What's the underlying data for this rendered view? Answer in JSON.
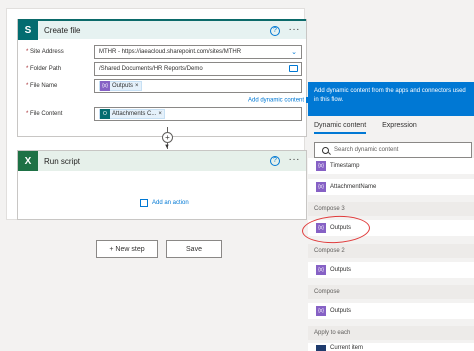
{
  "create_file": {
    "title": "Create file",
    "fields": [
      {
        "label": "Site Address",
        "value": "MTHR - https://iaeacloud.sharepoint.com/sites/MTHR"
      },
      {
        "label": "Folder Path",
        "value": "/Shared Documents/HR Reports/Demo"
      },
      {
        "label": "File Name",
        "token": "Outputs"
      },
      {
        "label": "File Content",
        "token": "Attachments C..."
      }
    ],
    "add_dynamic_content": "Add dynamic content"
  },
  "run_script": {
    "title": "Run script",
    "add_action": "Add an action"
  },
  "buttons": {
    "new_step": "+ New step",
    "save": "Save"
  },
  "dynamic_panel": {
    "banner": "Add dynamic content from the apps and connectors used in this flow.",
    "tabs": [
      "Dynamic content",
      "Expression"
    ],
    "search_placeholder": "Search dynamic content",
    "items": [
      {
        "label": "Timestamp",
        "icon": "variable-icon"
      },
      {
        "label": "AttachmentName",
        "icon": "variable-icon"
      }
    ],
    "groups": [
      {
        "header": "Compose 3",
        "item": "Outputs"
      },
      {
        "header": "Compose 2",
        "item": "Outputs"
      },
      {
        "header": "Compose",
        "item": "Outputs"
      },
      {
        "header": "Apply to each",
        "item": "Current item"
      }
    ]
  },
  "colors": {
    "accent": "#0078d4",
    "sharepoint": "#036c70",
    "excel": "#1e7145",
    "highlight_circle": "#e03b3b"
  }
}
